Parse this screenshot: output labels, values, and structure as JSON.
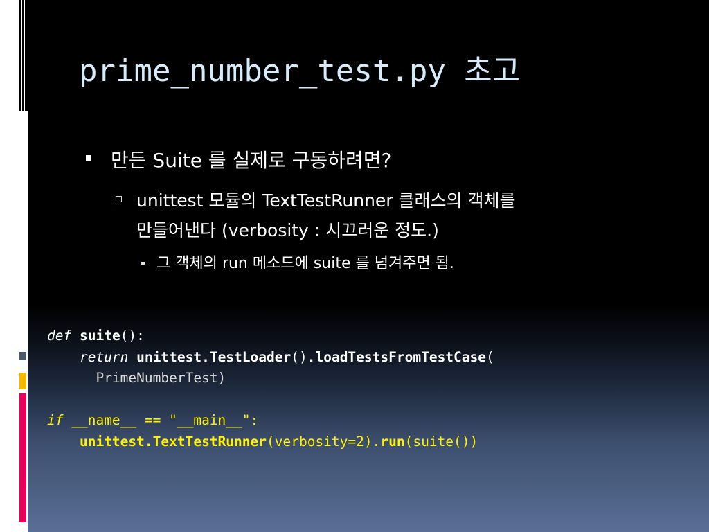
{
  "slide": {
    "title": "prime_number_test.py 초고",
    "bullets": {
      "level1": "만든 Suite 를 실제로  구동하려면?",
      "level2_line1": "unittest 모듈의 TextTestRunner 클래스의 객체를",
      "level2_line2": "만들어낸다 (verbosity : 시끄러운 정도.)",
      "level3": "그 객체의 run 메소드에 suite 를 넘겨주면 됨."
    },
    "code": {
      "line1": {
        "kw": "def",
        "name": "suite",
        "rest": "():"
      },
      "line2": {
        "kw": "return",
        "call": "unittest.TestLoader",
        "paren": "()",
        "dot": ".",
        "method": "loadTestsFromTestCase",
        "open": "("
      },
      "line3": {
        "arg": "PrimeNumberTest)"
      },
      "line5": {
        "kw": "if",
        "cond": "__name__ == \"__main__\":"
      },
      "line6": {
        "obj": "unittest.TextTestRunner",
        "args": "(verbosity=2).",
        "method": "run",
        "rest": "(suite())"
      }
    }
  },
  "colors": {
    "background": "#000000",
    "gradient_bottom": "#5a6f96",
    "title": "#d6ecfb",
    "code_highlight": "#fff200",
    "accent_gray": "#4a5a6a",
    "accent_yellow": "#f5b800",
    "accent_pink": "#e8005a"
  }
}
